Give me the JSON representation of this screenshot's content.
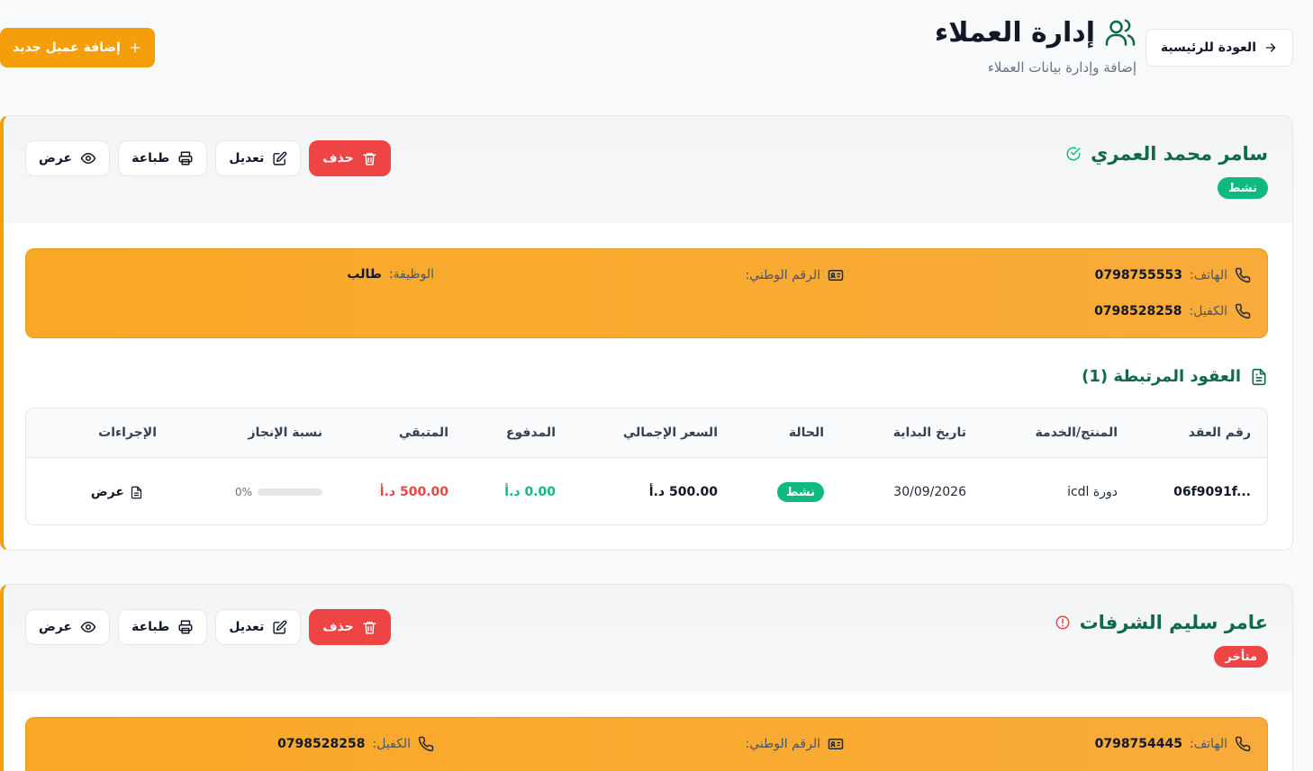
{
  "header": {
    "back_label": "العودة للرئيسية",
    "title": "إدارة العملاء",
    "subtitle": "إضافة وإدارة بيانات العملاء",
    "add_label": "إضافة عميل جديد"
  },
  "actions": {
    "view": "عرض",
    "print": "طباعة",
    "edit": "تعديل",
    "delete": "حذف"
  },
  "labels": {
    "phone": "الهاتف:",
    "national_id": "الرقم الوطني:",
    "job": "الوظيفة:",
    "guarantor": "الكفيل:"
  },
  "colors": {
    "primary_green": "#0f6b46",
    "accent_orange": "#f59e0b",
    "success": "#10b981",
    "danger": "#ef4444"
  },
  "clients": [
    {
      "name": "سامر محمد العمري",
      "status_icon": "check-circle-icon",
      "status": "نشط",
      "phone": "0798755553",
      "national_id": "",
      "job": "طالب",
      "guarantor": "0798528258",
      "contracts_title": "العقود المرتبطة (1)",
      "table": {
        "headers": [
          "رقم العقد",
          "المنتج/الخدمة",
          "تاريخ البداية",
          "الحالة",
          "السعر الإجمالي",
          "المدفوع",
          "المتبقي",
          "نسبة الإنجاز",
          "الإجراءات"
        ],
        "rows": [
          {
            "contract_no": "06f9091f...",
            "product": "دورة icdl",
            "start_date": "30/09/2026",
            "status": "نشط",
            "total": "500.00 د.أ",
            "paid": "0.00 د.أ",
            "remaining": "500.00 د.أ",
            "progress": 0,
            "progress_label": "0%",
            "action": "عرض"
          }
        ]
      }
    },
    {
      "name": "عامر سليم الشرفات",
      "status_icon": "alert-circle-icon",
      "status": "متأخر",
      "phone": "0798754445",
      "national_id": "",
      "guarantor": "0798528258"
    }
  ]
}
